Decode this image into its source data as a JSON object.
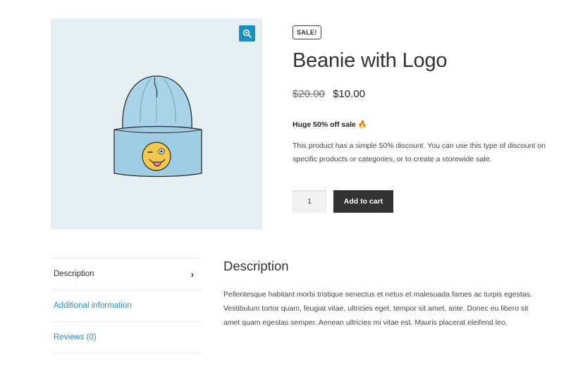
{
  "gallery": {
    "zoom_icon": "zoom-in-icon",
    "image_alt": "Beanie with Logo",
    "colors": {
      "background": "#e6f0f3",
      "beanie": "#a9d3e8",
      "logo": "#f2c94c",
      "zoom": "#1a8fc2"
    }
  },
  "product": {
    "badge": "SALE!",
    "title": "Beanie with Logo",
    "price_old": "$20.00",
    "price_new": "$10.00",
    "sale_note": "Huge 50% off sale 🔥",
    "description": "This product has a simple 50% discount. You can use this type of discount on specific products or categories, or to create a storewide sale.",
    "quantity": "1",
    "add_to_cart": "Add to cart"
  },
  "tabs": {
    "items": [
      {
        "label": "Description",
        "active": true
      },
      {
        "label": "Additional information",
        "active": false
      },
      {
        "label": "Reviews (0)",
        "active": false
      }
    ],
    "chevron_icon": "chevron-right-icon"
  },
  "panel": {
    "title": "Description",
    "text": "Pellentesque habitant morbi tristique senectus et netus et malesuada fames ac turpis egestas. Vestibulum tortor quam, feugiat vitae, ultricies eget, tempor sit amet, ante. Donec eu libero sit amet quam egestas semper. Aenean ultricies mi vitae est. Mauris placerat eleifend leo."
  },
  "theme": {
    "link": "#2c8ec0",
    "button": "#333333"
  }
}
